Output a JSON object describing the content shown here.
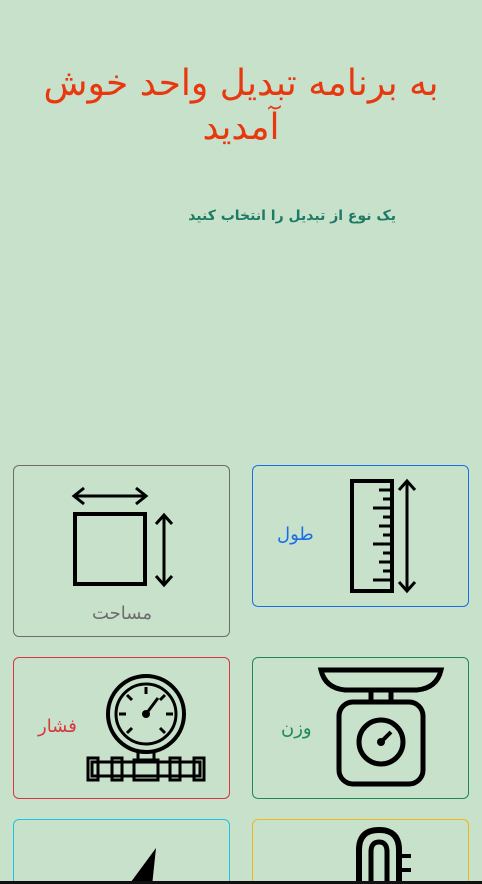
{
  "header": {
    "title": "به برنامه تبدیل واحد خوش آمدید",
    "subtitle": "یک نوع از تبدیل را انتخاب کنید"
  },
  "cards": {
    "length": {
      "label": "طول",
      "icon": "ruler-icon",
      "color": "#1a6ee8"
    },
    "area": {
      "label": "مساحت",
      "icon": "square-area-icon",
      "color": "#6d6d6d"
    },
    "weight": {
      "label": "وزن",
      "icon": "scale-icon",
      "color": "#1e8a4f"
    },
    "pressure": {
      "label": "فشار",
      "icon": "pressure-gauge-icon",
      "color": "#d9363e"
    },
    "temperature": {
      "icon": "thermometer-icon",
      "color": "#e9b81b"
    },
    "speed": {
      "icon": "speedometer-icon",
      "color": "#1ec3dd"
    }
  },
  "colors": {
    "background": "#c8e1cb",
    "title": "#e8380f",
    "subtitle": "#1d7a66"
  }
}
